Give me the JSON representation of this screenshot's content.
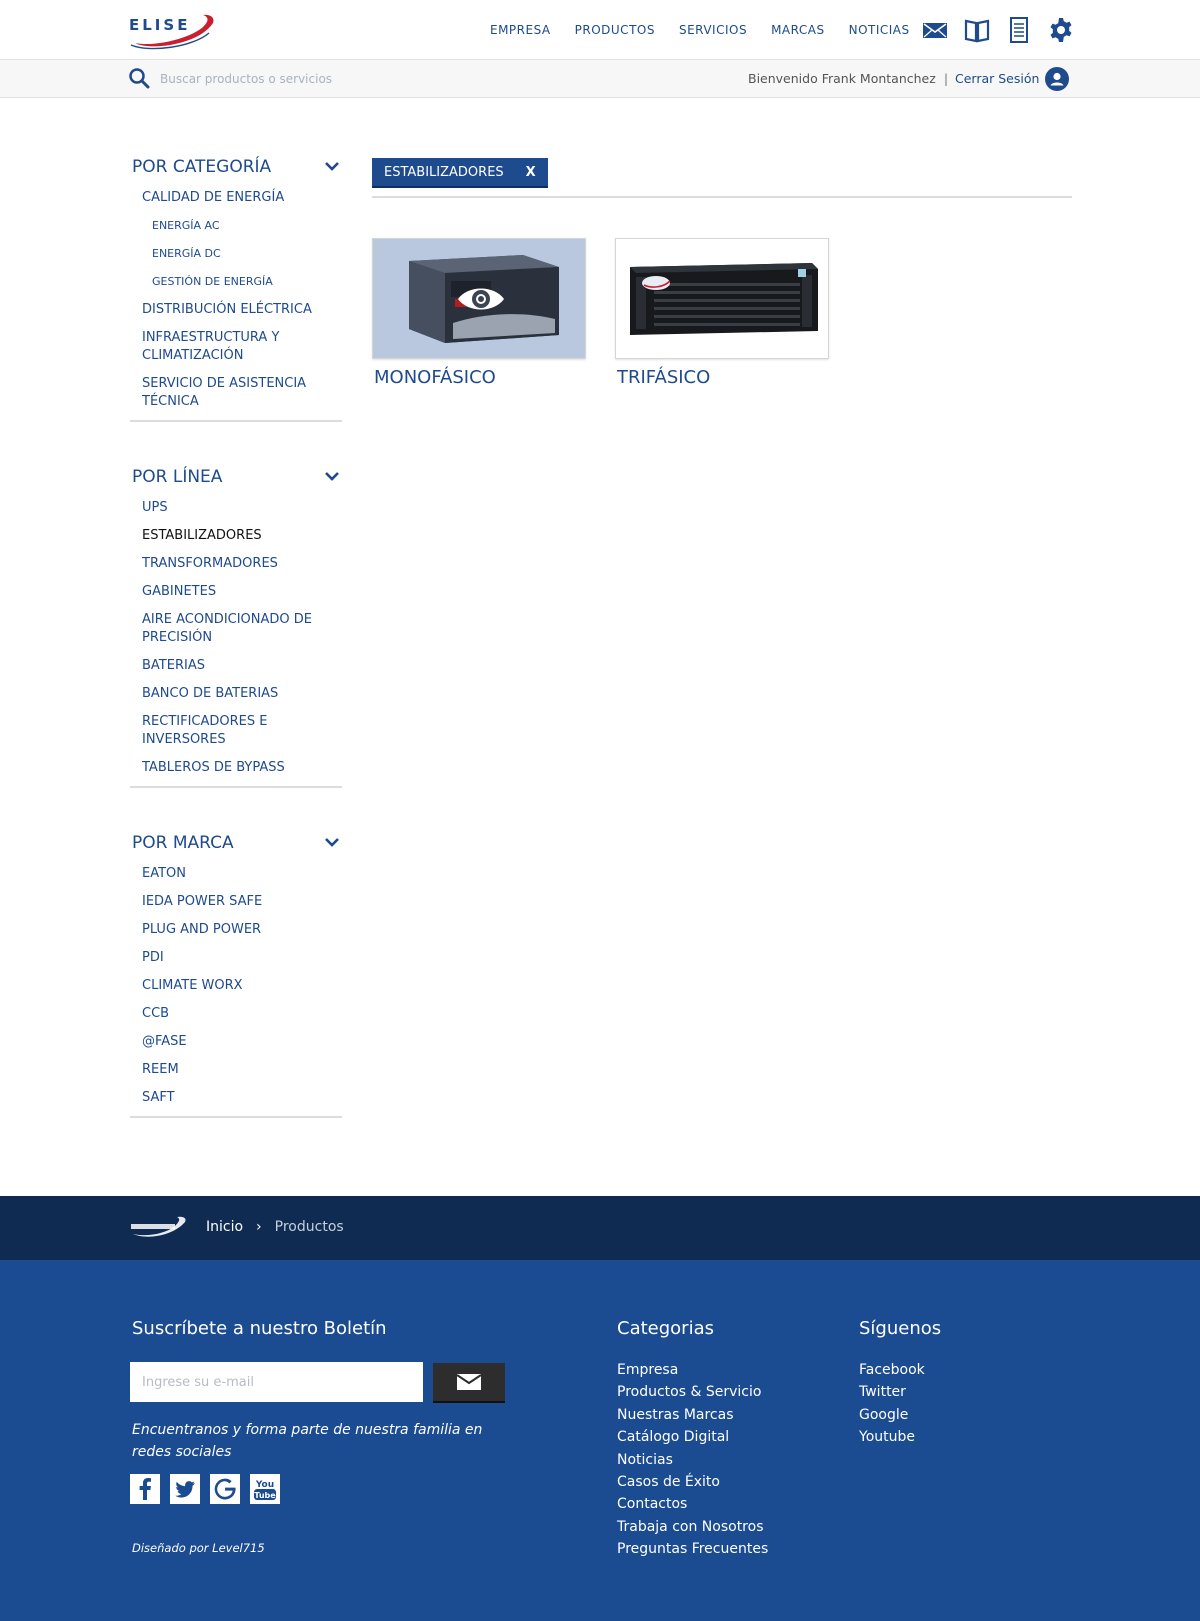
{
  "header": {
    "logo_text": "ELISE",
    "nav": [
      "EMPRESA",
      "PRODUCTOS",
      "SERVICIOS",
      "MARCAS",
      "NOTICIAS"
    ],
    "icons": [
      "mail-icon",
      "book-icon",
      "document-icon",
      "gear-icon"
    ]
  },
  "search": {
    "placeholder": "Buscar productos o servicios"
  },
  "user": {
    "welcome": "Bienvenido Frank Montanchez",
    "separator": "|",
    "logout": "Cerrar Sesión"
  },
  "sidebar": {
    "category": {
      "title": "POR CATEGORÍA",
      "items": [
        {
          "label": "CALIDAD DE ENERGÍA",
          "level": 1
        },
        {
          "label": "ENERGÍA AC",
          "level": 2
        },
        {
          "label": "ENERGÍA DC",
          "level": 2
        },
        {
          "label": "GESTIÓN DE ENERGÍA",
          "level": 2
        },
        {
          "label": "DISTRIBUCIÓN ELÉCTRICA",
          "level": 1
        },
        {
          "label": "INFRAESTRUCTURA Y CLIMATIZACIÓN",
          "level": 1
        },
        {
          "label": "SERVICIO DE ASISTENCIA TÉCNICA",
          "level": 1
        }
      ]
    },
    "line": {
      "title": "POR LÍNEA",
      "items": [
        "UPS",
        "ESTABILIZADORES",
        "TRANSFORMADORES",
        "GABINETES",
        "AIRE ACONDICIONADO DE PRECISIÓN",
        "BATERIAS",
        "BANCO DE BATERIAS",
        "RECTIFICADORES E INVERSORES",
        "TABLEROS DE BYPASS"
      ],
      "active": "ESTABILIZADORES"
    },
    "brand": {
      "title": "POR MARCA",
      "items": [
        "EATON",
        "IEDA POWER SAFE",
        "PLUG AND POWER",
        "PDI",
        "CLIMATE WORX",
        "CCB",
        "@FASE",
        "REEM",
        "SAFT"
      ]
    }
  },
  "filter": {
    "chip_label": "ESTABILIZADORES",
    "chip_close": "X"
  },
  "products": [
    {
      "name": "MONOFÁSICO",
      "hover": true
    },
    {
      "name": "TRIFÁSICO",
      "hover": false
    }
  ],
  "breadcrumb": {
    "home": "Inicio",
    "separator": "›",
    "current": "Productos"
  },
  "footer": {
    "newsletter_title": "Suscríbete a nuestro Boletín",
    "email_placeholder": "Ingrese su e-mail",
    "social_text": "Encuentranos y forma parte de nuestra familia en redes sociales",
    "credit": "Diseñado por Level715",
    "categories_title": "Categorias",
    "categories": [
      "Empresa",
      "Productos & Servicio",
      "Nuestras Marcas",
      "Catálogo Digital",
      "Noticias",
      "Casos de Éxito",
      "Contactos",
      "Trabaja con Nosotros",
      "Preguntas Frecuentes"
    ],
    "follow_title": "Síguenos",
    "follow": [
      "Facebook",
      "Twitter",
      "Google",
      "Youtube"
    ],
    "social_icons": [
      "facebook-icon",
      "twitter-icon",
      "google-icon",
      "youtube-icon"
    ]
  },
  "colors": {
    "primary": "#1e4a8e",
    "footer_dark": "#0f2b52",
    "footer": "#1b4b91",
    "accent_red": "#c8202f"
  }
}
